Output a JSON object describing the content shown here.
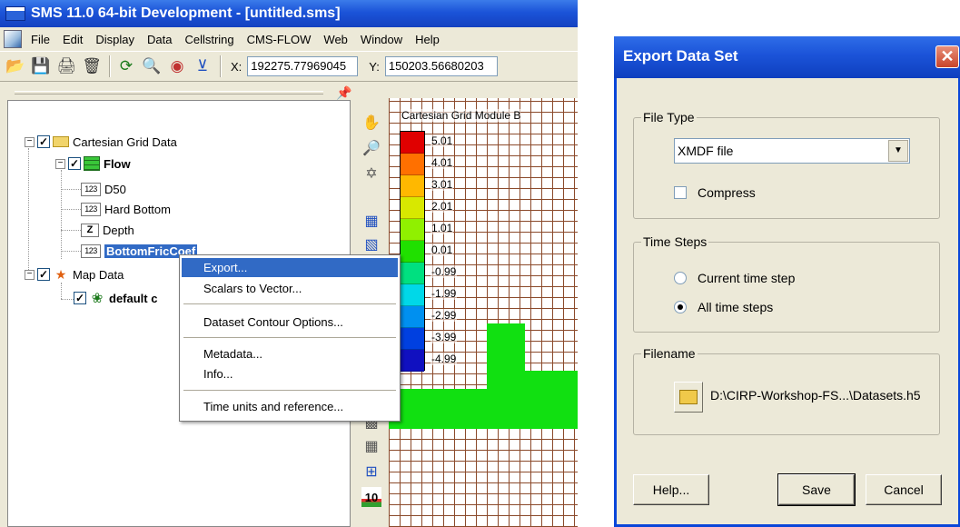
{
  "main_window": {
    "title": "SMS 11.0 64-bit Development - [untitled.sms]",
    "menu": [
      "File",
      "Edit",
      "Display",
      "Data",
      "Cellstring",
      "CMS-FLOW",
      "Web",
      "Window",
      "Help"
    ],
    "coords": {
      "x_label": "X:",
      "x_value": "192275.77969045",
      "y_label": "Y:",
      "y_value": "150203.56680203"
    }
  },
  "tree": {
    "cartesian_grid_data": "Cartesian Grid Data",
    "flow": "Flow",
    "d50": "D50",
    "hard_bottom": "Hard Bottom",
    "depth": "Depth",
    "bottom_fric": "BottomFricCoef",
    "map_data": "Map Data",
    "default_coverage": "default c",
    "icon_123": "123",
    "icon_z": "Z"
  },
  "graphics": {
    "title": "Cartesian Grid Module B",
    "legend": {
      "labels": [
        "5.01",
        "4.01",
        "3.01",
        "2.01",
        "1.01",
        "0.01",
        "-0.99",
        "-1.99",
        "-2.99",
        "-3.99",
        "-4.99"
      ],
      "colors": [
        "#e00000",
        "#ff7000",
        "#ffb800",
        "#d8e800",
        "#90f000",
        "#20e000",
        "#00e080",
        "#00d8e8",
        "#0090f0",
        "#0040e0",
        "#1010c0"
      ]
    }
  },
  "context_menu": {
    "items": {
      "export": "Export...",
      "scalars_to_vector": "Scalars to Vector...",
      "dataset_contour": "Dataset Contour Options...",
      "metadata": "Metadata...",
      "info": "Info...",
      "time_units": "Time units and reference..."
    }
  },
  "dialog": {
    "title": "Export Data Set",
    "file_type": {
      "label": "File Type",
      "selected": "XMDF file",
      "compress_label": "Compress",
      "compress_checked": false
    },
    "time_steps": {
      "label": "Time Steps",
      "current": "Current time step",
      "all": "All time steps",
      "selected": "all"
    },
    "filename": {
      "label": "Filename",
      "value": "D:\\CIRP-Workshop-FS...\\Datasets.h5"
    },
    "buttons": {
      "help": "Help...",
      "save": "Save",
      "cancel": "Cancel"
    }
  }
}
